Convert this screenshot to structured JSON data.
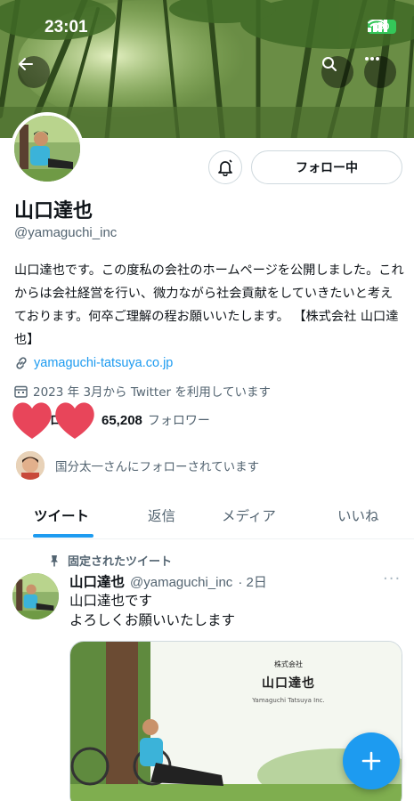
{
  "status_bar": {
    "time": "23:01",
    "battery": "100"
  },
  "profile": {
    "display_name": "山口達也",
    "handle": "@yamaguchi_inc",
    "bio": "山口達也です。この度私の会社のホームページを公開しました。これからは会社経営を行い、微力ながら社会貢献をしていきたいと考えております。何卒ご理解の程お願いいたします。 【株式会社 山口達也】",
    "link": "yamaguchi-tatsuya.co.jp",
    "joined": "2023 年 3月から Twitter を利用しています",
    "followers_count": "65,208",
    "followers_label": "フォロワー",
    "following_count_hidden": "ロ",
    "followed_by": "国分太一さんにフォローされています",
    "follow_button_label": "フォロー中"
  },
  "tabs": [
    {
      "label": "ツイート",
      "active": true
    },
    {
      "label": "返信",
      "active": false
    },
    {
      "label": "メディア",
      "active": false
    },
    {
      "label": "いいね",
      "active": false
    }
  ],
  "tweet": {
    "pinned_label": "固定されたツイート",
    "author_name": "山口達也",
    "author_handle": "@yamaguchi_inc",
    "time": "· 2日",
    "more": "···",
    "lines": [
      "山口達也です",
      "よろしくお願いいたします"
    ],
    "card": {
      "company": "株式会社",
      "name": "山口達也",
      "roman": "Yamaguchi Tatsuya Inc."
    }
  },
  "colors": {
    "accent": "#1d9bf0",
    "heart": "#e8455a",
    "battery": "#34c759"
  },
  "icons": [
    "back-arrow-icon",
    "search-icon",
    "more-icon",
    "bell-icon",
    "link-icon",
    "calendar-icon",
    "pin-icon",
    "plus-icon"
  ]
}
